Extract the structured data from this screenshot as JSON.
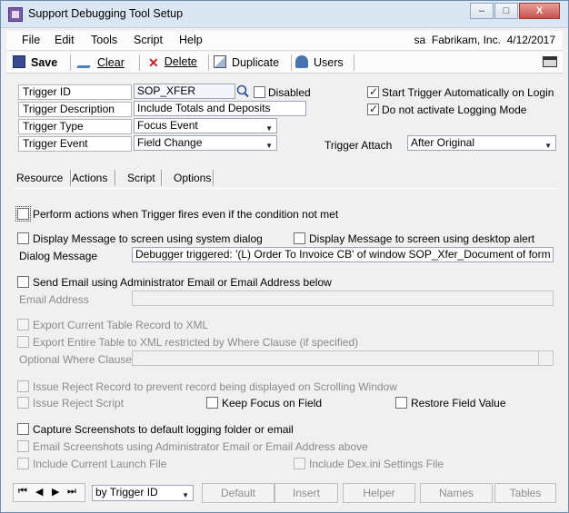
{
  "window": {
    "title": "Support Debugging Tool Setup",
    "minimize": "–",
    "restore": "□",
    "close": "X"
  },
  "menubar": {
    "items": [
      "File",
      "Edit",
      "Tools",
      "Script",
      "Help"
    ],
    "user": "sa",
    "company": "Fabrikam, Inc.",
    "date": "4/12/2017"
  },
  "toolbar": {
    "save": "Save",
    "clear": "Clear",
    "delete": "Delete",
    "duplicate": "Duplicate",
    "users": "Users"
  },
  "header": {
    "trigger_id_label": "Trigger ID",
    "trigger_id_value": "SOP_XFER",
    "disabled_label": "Disabled",
    "trigger_description_label": "Trigger Description",
    "trigger_description_value": "Include Totals and Deposits",
    "trigger_type_label": "Trigger Type",
    "trigger_type_value": "Focus Event",
    "trigger_event_label": "Trigger Event",
    "trigger_event_value": "Field Change",
    "start_auto_label": "Start Trigger Automatically on Login",
    "no_logging_label": "Do not activate Logging Mode",
    "trigger_attach_label": "Trigger Attach",
    "trigger_attach_value": "After Original"
  },
  "tabs": [
    "Resource",
    "Actions",
    "Script",
    "Options"
  ],
  "actions": {
    "perform_actions": "Perform actions when Trigger fires even if the condition not met",
    "display_system_dialog": "Display Message to screen using system dialog",
    "display_desktop_alert": "Display Message to screen using desktop alert",
    "dialog_message_label": "Dialog Message",
    "dialog_message_value": "Debugger triggered: '(L) Order To Invoice CB' of window SOP_Xfer_Document of form SOP_Xfer.",
    "send_email": "Send Email using Administrator Email or Email Address below",
    "email_address_label": "Email Address",
    "export_record": "Export Current Table Record to XML",
    "export_table": "Export Entire Table to XML restricted by Where Clause (if specified)",
    "optional_where_label": "Optional Where Clause",
    "issue_reject_record": "Issue Reject Record to prevent record being displayed on Scrolling Window",
    "issue_reject_script": "Issue Reject Script",
    "keep_focus": "Keep Focus on Field",
    "restore_field": "Restore Field Value",
    "capture_screenshots": "Capture Screenshots to default logging folder or email",
    "email_screenshots": "Email Screenshots using Administrator Email or Email Address above",
    "include_launch": "Include Current Launch File",
    "include_dexini": "Include Dex.ini Settings File"
  },
  "bottom": {
    "sort_value": "by Trigger ID",
    "default": "Default",
    "insert": "Insert",
    "helper": "Helper",
    "names": "Names",
    "tables": "Tables"
  },
  "icons": {
    "save": "save-icon",
    "clear": "eraser-icon",
    "delete": "x-icon",
    "duplicate": "duplicate-icon",
    "users": "users-icon",
    "print": "printer-icon"
  }
}
